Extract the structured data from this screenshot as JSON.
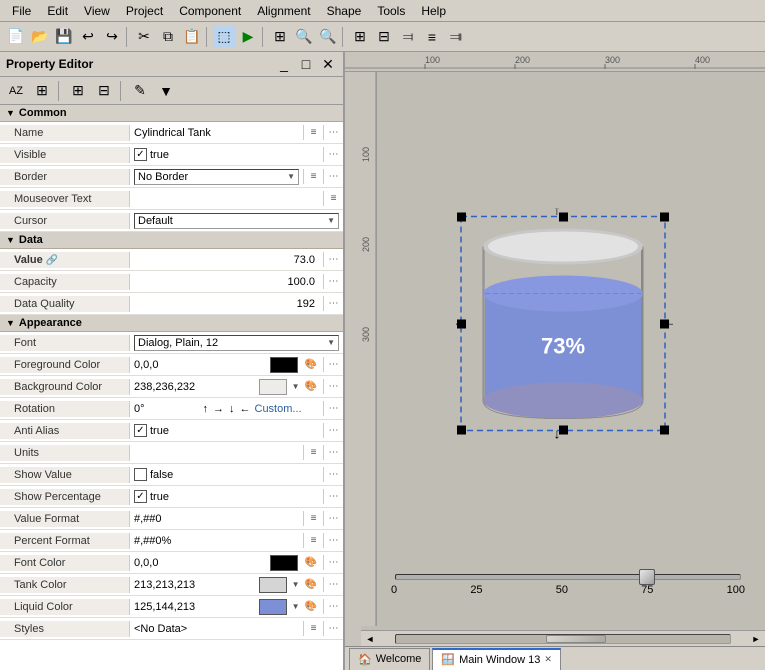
{
  "menubar": {
    "items": [
      "File",
      "Edit",
      "View",
      "Project",
      "Component",
      "Alignment",
      "Shape",
      "Tools",
      "Help"
    ]
  },
  "prop_editor": {
    "title": "Property Editor",
    "sections": {
      "common": {
        "label": "Common",
        "rows": [
          {
            "label": "Name",
            "value": "Cylindrical Tank",
            "type": "text"
          },
          {
            "label": "Visible",
            "value": "true",
            "type": "checkbox_true"
          },
          {
            "label": "Border",
            "value": "No Border",
            "type": "dropdown"
          },
          {
            "label": "Mouseover Text",
            "value": "",
            "type": "text_edit"
          },
          {
            "label": "Cursor",
            "value": "Default",
            "type": "dropdown"
          }
        ]
      },
      "data": {
        "label": "Data",
        "rows": [
          {
            "label": "Value",
            "value": "73.0",
            "type": "number_link"
          },
          {
            "label": "Capacity",
            "value": "100.0",
            "type": "number"
          },
          {
            "label": "Data Quality",
            "value": "192",
            "type": "number"
          }
        ]
      },
      "appearance": {
        "label": "Appearance",
        "rows": [
          {
            "label": "Font",
            "value": "Dialog, Plain, 12",
            "type": "dropdown"
          },
          {
            "label": "Foreground Color",
            "value": "0,0,0",
            "type": "color",
            "color": "#000000"
          },
          {
            "label": "Background Color",
            "value": "238,236,232",
            "type": "color_dropdown",
            "color": "#eeece8"
          },
          {
            "label": "Rotation",
            "value": "0°",
            "type": "rotation"
          },
          {
            "label": "Anti Alias",
            "value": "true",
            "type": "checkbox_true"
          },
          {
            "label": "Units",
            "value": "",
            "type": "text_edit2"
          },
          {
            "label": "Show Value",
            "value": "false",
            "type": "checkbox_false"
          },
          {
            "label": "Show Percentage",
            "value": "true",
            "type": "checkbox_true"
          },
          {
            "label": "Value Format",
            "value": "#,##0",
            "type": "text_edit2"
          },
          {
            "label": "Percent Format",
            "value": "#,##0%",
            "type": "text_edit2"
          },
          {
            "label": "Font Color",
            "value": "0,0,0",
            "type": "color",
            "color": "#000000"
          },
          {
            "label": "Tank Color",
            "value": "213,213,213",
            "type": "color_dropdown",
            "color": "#d5d5d5"
          },
          {
            "label": "Liquid Color",
            "value": "125,144,213",
            "type": "color_dropdown_blue",
            "color": "#7d90d5"
          },
          {
            "label": "Styles",
            "value": "<No Data>",
            "type": "text_edit2"
          }
        ]
      }
    }
  },
  "canvas": {
    "tank_percent": "73%",
    "slider": {
      "labels": [
        "0",
        "25",
        "50",
        "75",
        "100"
      ],
      "value": 73
    }
  },
  "tabs": [
    {
      "label": "Welcome",
      "icon": "home-icon",
      "active": false
    },
    {
      "label": "Main Window 13",
      "icon": "window-icon",
      "active": true,
      "closeable": true
    }
  ]
}
